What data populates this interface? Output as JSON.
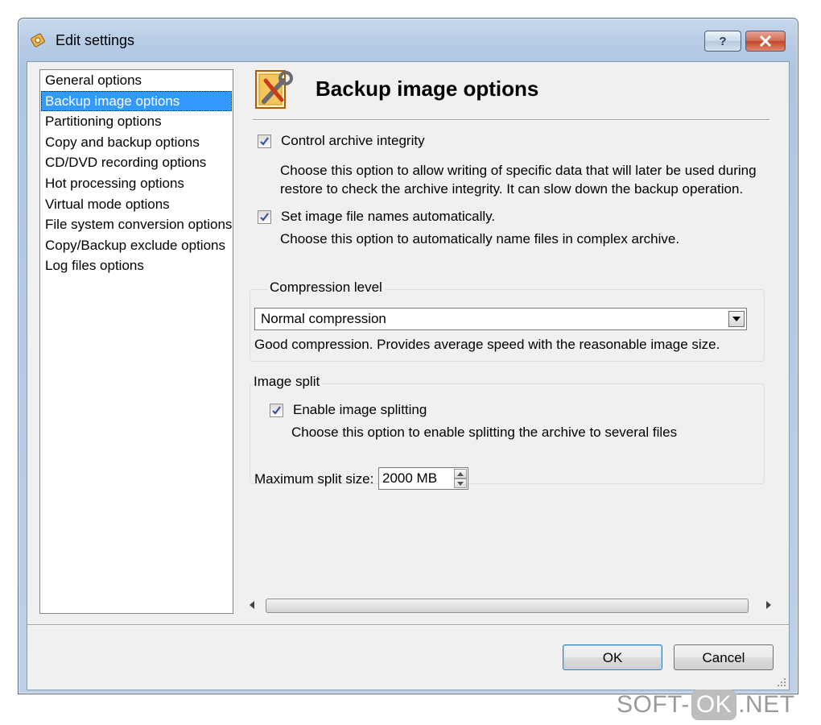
{
  "window": {
    "title": "Edit settings",
    "help_label": "?",
    "close_label": "✕"
  },
  "nav": {
    "items": [
      {
        "label": "General options"
      },
      {
        "label": "Backup image options",
        "selected": true
      },
      {
        "label": "Partitioning options"
      },
      {
        "label": "Copy and backup options"
      },
      {
        "label": "CD/DVD recording options"
      },
      {
        "label": "Hot processing options"
      },
      {
        "label": "Virtual mode options"
      },
      {
        "label": "File system conversion options"
      },
      {
        "label": "Copy/Backup exclude options"
      },
      {
        "label": "Log files options"
      }
    ]
  },
  "content": {
    "title": "Backup image options",
    "control_integrity": {
      "label": "Control archive integrity",
      "checked": true,
      "desc_line1": "Choose this option to allow writing of specific data that will later be used during",
      "desc_line2": "restore to check the archive integrity. It can slow down the backup operation."
    },
    "auto_names": {
      "label": "Set image file names automatically.",
      "checked": true,
      "desc": "Choose this option to automatically name files in complex archive."
    },
    "compression": {
      "group_label": "Compression level",
      "selected": "Normal compression",
      "desc": "Good compression. Provides average speed with the reasonable image size."
    },
    "split": {
      "group_label": "Image split",
      "enable_label": "Enable image splitting",
      "checked": true,
      "desc": "Choose this option to enable splitting the archive to several files",
      "max_size_label": "Maximum split size:",
      "max_size_value": "2000 MB"
    }
  },
  "buttons": {
    "ok": "OK",
    "cancel": "Cancel"
  },
  "watermark": {
    "left": "SOFT-",
    "box": "OK",
    "right": ".NET"
  },
  "colors": {
    "selection": "#3399ff",
    "dialog_bg": "#f0f0f0",
    "close_button": "#c4452a"
  }
}
